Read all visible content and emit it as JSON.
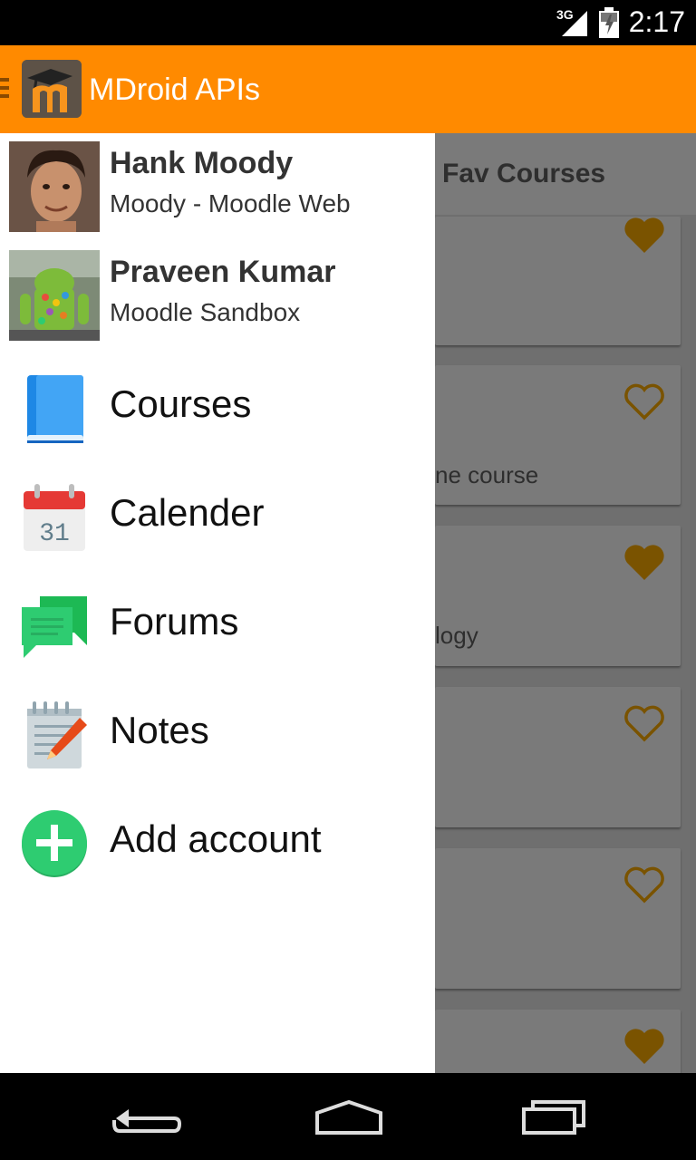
{
  "status": {
    "network": "3G",
    "time": "2:17"
  },
  "appbar": {
    "title": "MDroid APIs"
  },
  "background": {
    "title": "Fav Courses",
    "cards": [
      {
        "text": "",
        "fav": true
      },
      {
        "text": "ne course",
        "fav": false
      },
      {
        "text": "logy",
        "fav": true
      },
      {
        "text": "",
        "fav": false
      },
      {
        "text": "",
        "fav": false
      },
      {
        "text": "",
        "fav": true
      }
    ]
  },
  "drawer": {
    "accounts": [
      {
        "name": "Hank Moody",
        "subtitle": "Moody - Moodle Web"
      },
      {
        "name": "Praveen Kumar",
        "subtitle": "Moodle Sandbox"
      }
    ],
    "items": [
      {
        "label": "Courses",
        "icon": "book-icon"
      },
      {
        "label": "Calender",
        "icon": "calendar-icon",
        "icon_text": "31"
      },
      {
        "label": "Forums",
        "icon": "chat-icon"
      },
      {
        "label": "Notes",
        "icon": "notepad-icon"
      },
      {
        "label": "Add account",
        "icon": "plus-circle-icon"
      }
    ]
  },
  "colors": {
    "primary": "#FF8A00",
    "heart": "#7a5300",
    "drawer_bg": "#FFFFFF"
  }
}
